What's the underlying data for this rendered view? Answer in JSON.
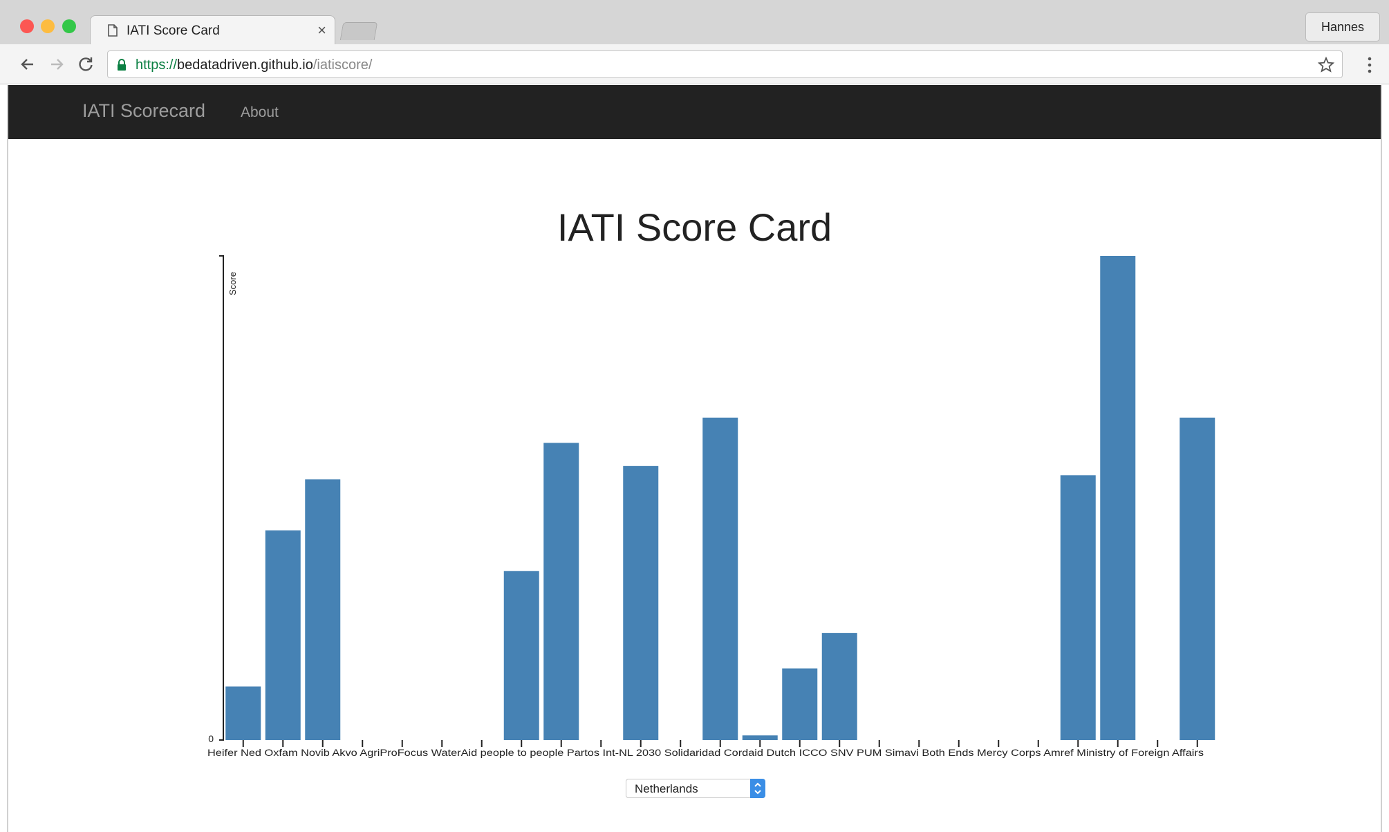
{
  "browser": {
    "tab_title": "IATI Score Card",
    "tab_close": "×",
    "profile_name": "Hannes",
    "url_scheme": "https://",
    "url_host": "bedatadriven.github.io",
    "url_path": "/iatiscore/"
  },
  "site": {
    "brand": "IATI Scorecard",
    "nav_about": "About",
    "page_title": "IATI Score Card"
  },
  "chart_data": {
    "type": "bar",
    "ylabel": "Score",
    "y_tick_label": "0",
    "color": "#4682b4",
    "ylim": [
      0,
      94
    ],
    "categories": [
      "Heifer Nederland",
      "Oxfam Novib",
      "Akvo",
      "AgriProFocus",
      "WaterAid",
      "",
      "",
      "",
      "",
      "",
      "",
      "",
      "",
      "Int-NL",
      "",
      "",
      "",
      "",
      "",
      "",
      "",
      "",
      "",
      "",
      "",
      "",
      "",
      "",
      "",
      "Ministry of Foreign Affairs",
      "",
      ""
    ],
    "values": [
      10.4,
      40.7,
      50.6,
      0,
      0,
      0,
      0,
      32.8,
      57.7,
      0,
      53.2,
      0,
      62.6,
      0.9,
      13.9,
      20.8,
      0,
      0,
      0,
      0,
      0,
      51.4,
      94,
      0,
      62.6,
      0
    ],
    "tick_text": "Heifer Ned    Oxfam Novib  Akvo  AgriProFocus  WaterAid    people to people  Partos   Int-NL   2030  Solidaridad  Cordaid  Dutch  ICCO  SNV  PUM  Simavi  Both Ends  Mercy Corps  Amref  Ministry of Foreign Affairs"
  },
  "controls": {
    "country_select": "Netherlands"
  }
}
